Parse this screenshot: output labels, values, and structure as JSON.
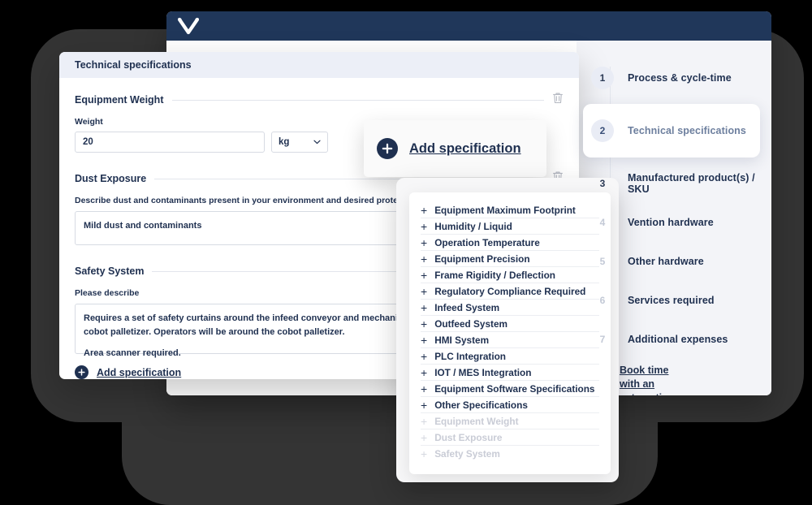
{
  "app": {
    "logo_icon": "vention-v-logo"
  },
  "panel": {
    "header_title": "Technical specifications",
    "sections": [
      {
        "title": "Equipment Weight",
        "field_label": "Weight",
        "value": "20",
        "unit": "kg",
        "unit_icon": "chevron-down-icon",
        "delete_icon": "trash-icon"
      },
      {
        "title": "Dust Exposure",
        "helper": "Describe dust and contaminants present in your environment and desired protection",
        "value": "Mild dust and contaminants",
        "delete_icon": "trash-icon"
      },
      {
        "title": "Safety System",
        "helper": "Please describe",
        "value_line_1": "Requires a set of safety curtains around the infeed conveyor and mechanical safety",
        "value_line_2": "cobot palletizer. Operators will be around the cobot palletizer.",
        "value_line_3": "Area scanner required.",
        "delete_icon": "trash-icon"
      }
    ],
    "add_spec_label": "Add specification",
    "add_icon": "plus-circle-icon"
  },
  "add_card": {
    "label": "Add specification",
    "icon": "plus-circle-icon"
  },
  "dropdown": {
    "options": [
      {
        "label": "Equipment Maximum Footprint",
        "disabled": false
      },
      {
        "label": "Humidity / Liquid",
        "disabled": false
      },
      {
        "label": "Operation Temperature",
        "disabled": false
      },
      {
        "label": "Equipment Precision",
        "disabled": false
      },
      {
        "label": "Frame Rigidity / Deflection",
        "disabled": false
      },
      {
        "label": "Regulatory Compliance Required",
        "disabled": false
      },
      {
        "label": "Infeed System",
        "disabled": false
      },
      {
        "label": "Outfeed System",
        "disabled": false
      },
      {
        "label": "HMI System",
        "disabled": false
      },
      {
        "label": "PLC Integration",
        "disabled": false
      },
      {
        "label": "IOT / MES Integration",
        "disabled": false
      },
      {
        "label": "Equipment Software Specifications",
        "disabled": false
      },
      {
        "label": "Other Specifications",
        "disabled": false
      },
      {
        "label": "Equipment Weight",
        "disabled": true
      },
      {
        "label": "Dust Exposure",
        "disabled": true
      },
      {
        "label": "Safety System",
        "disabled": true
      }
    ],
    "item_icon": "plus-icon"
  },
  "steps": {
    "items": [
      {
        "num": "1",
        "label": "Process & cycle-time",
        "active": false,
        "dim": false
      },
      {
        "num": "2",
        "label": "Technical specifications",
        "active": true,
        "dim": false
      },
      {
        "num": "3",
        "label": "Manufactured product(s) / SKU",
        "active": false,
        "dim": false
      },
      {
        "num": "4",
        "label": "Vention hardware",
        "active": false,
        "dim": true
      },
      {
        "num": "5",
        "label": "Other hardware",
        "active": false,
        "dim": true
      },
      {
        "num": "6",
        "label": "Services required",
        "active": false,
        "dim": true
      },
      {
        "num": "7",
        "label": "Additional expenses",
        "active": false,
        "dim": true
      }
    ],
    "expert_link": "Book time with an automation expert"
  },
  "colors": {
    "brand_navy": "#20375a",
    "text_navy": "#1f3050",
    "panel_header": "#eceff7",
    "backdrop_dark": "#343434",
    "muted": "#c9ccd6"
  }
}
